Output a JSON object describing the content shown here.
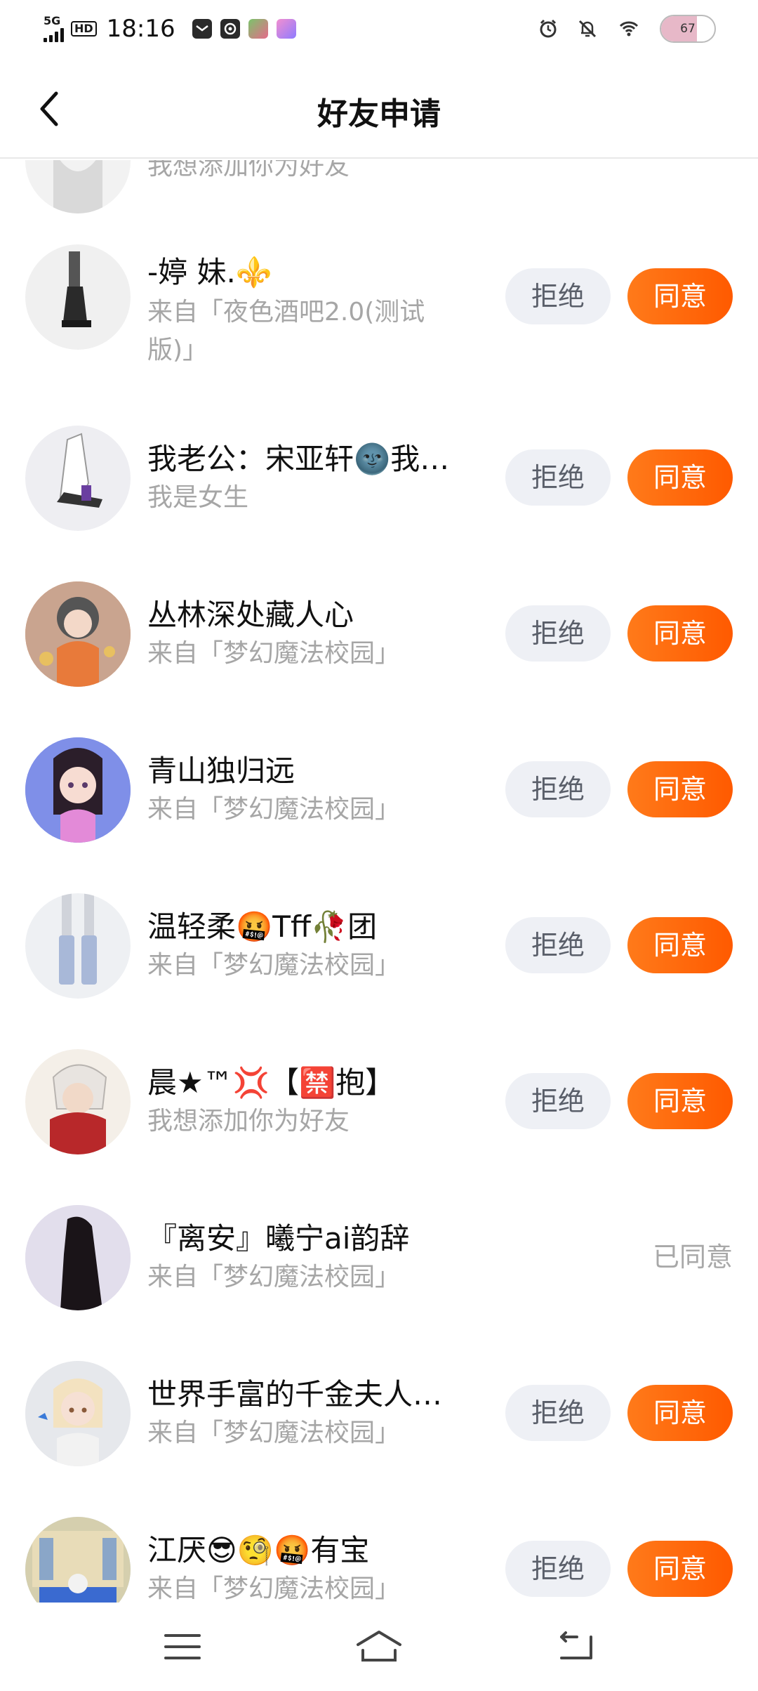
{
  "status_bar": {
    "network": "5G",
    "hd": "HD",
    "time": "18:16",
    "battery_percent": 67,
    "battery_label": "67",
    "apps": [
      "mail-app-icon",
      "at-app-icon",
      "game-app-icon-1",
      "game-app-icon-2"
    ]
  },
  "header": {
    "title": "好友申请",
    "back_icon": "chevron-left-icon"
  },
  "requests": [
    {
      "name": "",
      "subtitle": "我想添加你为好友",
      "status": "partial"
    },
    {
      "name": "-婷  妹.⚜️",
      "subtitle": "来自「夜色酒吧2.0(测试版)」",
      "status": "pending"
    },
    {
      "name": "我老公：宋亚轩🌚我…",
      "subtitle": "我是女生",
      "status": "pending"
    },
    {
      "name": "丛林深处藏人心",
      "subtitle": "来自「梦幻魔法校园」",
      "status": "pending"
    },
    {
      "name": "青山独归远",
      "subtitle": "来自「梦幻魔法校园」",
      "status": "pending"
    },
    {
      "name": "温轻柔🤬Tff🥀团",
      "subtitle": "来自「梦幻魔法校园」",
      "status": "pending"
    },
    {
      "name": "晨★™💢【🈲抱】",
      "subtitle": "我想添加你为好友",
      "status": "pending"
    },
    {
      "name": "『离安』曦宁ai韵辞",
      "subtitle": "来自「梦幻魔法校园」",
      "status": "agreed"
    },
    {
      "name": "世界手富的千金夫人…",
      "subtitle": "来自「梦幻魔法校园」",
      "status": "pending"
    },
    {
      "name": "江厌😎🧐🤬有宝",
      "subtitle": "来自「梦幻魔法校园」",
      "status": "pending"
    }
  ],
  "buttons": {
    "reject": "拒绝",
    "agree": "同意",
    "agreed": "已同意"
  },
  "nav": {
    "menu_icon": "menu-icon",
    "home_icon": "home-icon",
    "back_icon": "back-icon"
  },
  "colors": {
    "accent": "#ff6010",
    "reject_bg": "#eef0f5",
    "subtitle": "#a6a6a6"
  }
}
